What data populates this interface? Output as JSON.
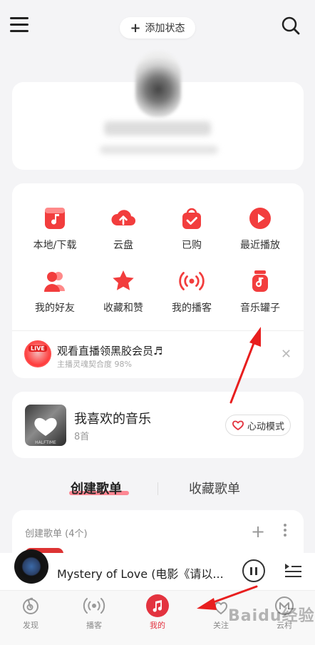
{
  "top": {
    "add_status_label": "添加状态"
  },
  "grid": {
    "items": [
      {
        "label": "本地/下载",
        "icon": "music-file-icon"
      },
      {
        "label": "云盘",
        "icon": "cloud-upload-icon"
      },
      {
        "label": "已购",
        "icon": "shopping-bag-icon"
      },
      {
        "label": "最近播放",
        "icon": "play-circle-icon"
      },
      {
        "label": "我的好友",
        "icon": "friends-icon"
      },
      {
        "label": "收藏和赞",
        "icon": "star-icon"
      },
      {
        "label": "我的播客",
        "icon": "podcast-icon"
      },
      {
        "label": "音乐罐子",
        "icon": "music-jar-icon"
      }
    ]
  },
  "live_promo": {
    "badge": "LIVE",
    "title": "观看直播领黑胶会员♬",
    "subtitle": "主播灵魂契合度 98%"
  },
  "liked": {
    "title": "我喜欢的音乐",
    "count": "8首",
    "cover_text": "HALFTIME",
    "heart_mode_label": "心动模式"
  },
  "tabs": {
    "created": "创建歌单",
    "collected": "收藏歌单"
  },
  "playlist_section": {
    "header": "创建歌单 (4个)"
  },
  "player": {
    "song_title": "Mystery of Love (电影《请以..."
  },
  "bottom_nav": {
    "items": [
      {
        "label": "发现"
      },
      {
        "label": "播客"
      },
      {
        "label": "我的"
      },
      {
        "label": "关注"
      },
      {
        "label": "云村"
      }
    ]
  },
  "watermark": "Baidu经验",
  "colors": {
    "accent": "#e3333f",
    "icon_red": "#f23d3d",
    "background": "#f4f4f6"
  }
}
